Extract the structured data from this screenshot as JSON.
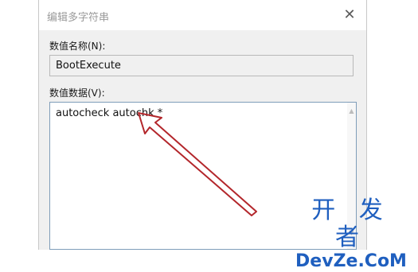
{
  "dialog": {
    "title": "编辑多字符串",
    "close_glyph": "✕"
  },
  "value_name": {
    "label": "数值名称(N):",
    "value": "BootExecute"
  },
  "value_data": {
    "label": "数值数据(V):",
    "value": "autocheck autochk *"
  },
  "scrollbar": {
    "up_glyph": "▲",
    "down_glyph": "▼"
  },
  "watermark": {
    "cn": "开 发 者",
    "en": "DevZe.CoM",
    "color": "#1f5fbf"
  },
  "annotation": {
    "arrow_color": "#b3262b"
  }
}
